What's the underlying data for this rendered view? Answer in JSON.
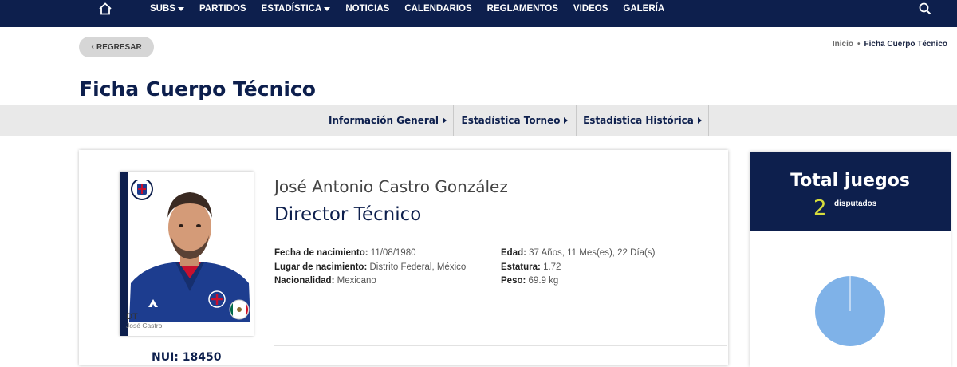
{
  "nav": {
    "items": [
      {
        "label": "SUBS",
        "dropdown": true
      },
      {
        "label": "PARTIDOS",
        "dropdown": false
      },
      {
        "label": "ESTADÍSTICA",
        "dropdown": true
      },
      {
        "label": "NOTICIAS",
        "dropdown": false
      },
      {
        "label": "CALENDARIOS",
        "dropdown": false
      },
      {
        "label": "REGLAMENTOS",
        "dropdown": false
      },
      {
        "label": "VIDEOS",
        "dropdown": false
      },
      {
        "label": "GALERÍA",
        "dropdown": false
      }
    ],
    "icons": {
      "home": "home-icon",
      "search": "search-icon"
    }
  },
  "back_label": "REGRESAR",
  "breadcrumb": {
    "home": "Inicio",
    "separator": "•",
    "current": "Ficha Cuerpo Técnico"
  },
  "page_title": "Ficha Cuerpo Técnico",
  "tabs": [
    "Información General",
    "Estadística Torneo",
    "Estadística Histórica"
  ],
  "profile": {
    "full_name": "José Antonio Castro González",
    "role": "Director Técnico",
    "card_position": "DT",
    "card_name": "José Castro",
    "nui": "NUI: 18450",
    "left_fields": [
      {
        "label": "Fecha de nacimiento:",
        "value": "11/08/1980"
      },
      {
        "label": "Lugar de nacimiento:",
        "value": "Distrito Federal, México"
      },
      {
        "label": "Nacionalidad:",
        "value": "Mexicano"
      }
    ],
    "right_fields": [
      {
        "label": "Edad:",
        "value": "37 Años, 11 Mes(es), 22 Día(s)"
      },
      {
        "label": "Estatura:",
        "value": "1.72"
      },
      {
        "label": "Peso:",
        "value": "69.9 kg"
      }
    ]
  },
  "totals": {
    "title": "Total juegos",
    "count": "2",
    "label": "disputados",
    "pie_fill_fraction": 1.0
  },
  "colors": {
    "navy": "#0d1f4d",
    "accent_yellow": "#d6dc3c",
    "pie_blue": "#7fb2e8",
    "tab_bg": "#e9e9e9",
    "button_gray": "#d6d6d6"
  }
}
